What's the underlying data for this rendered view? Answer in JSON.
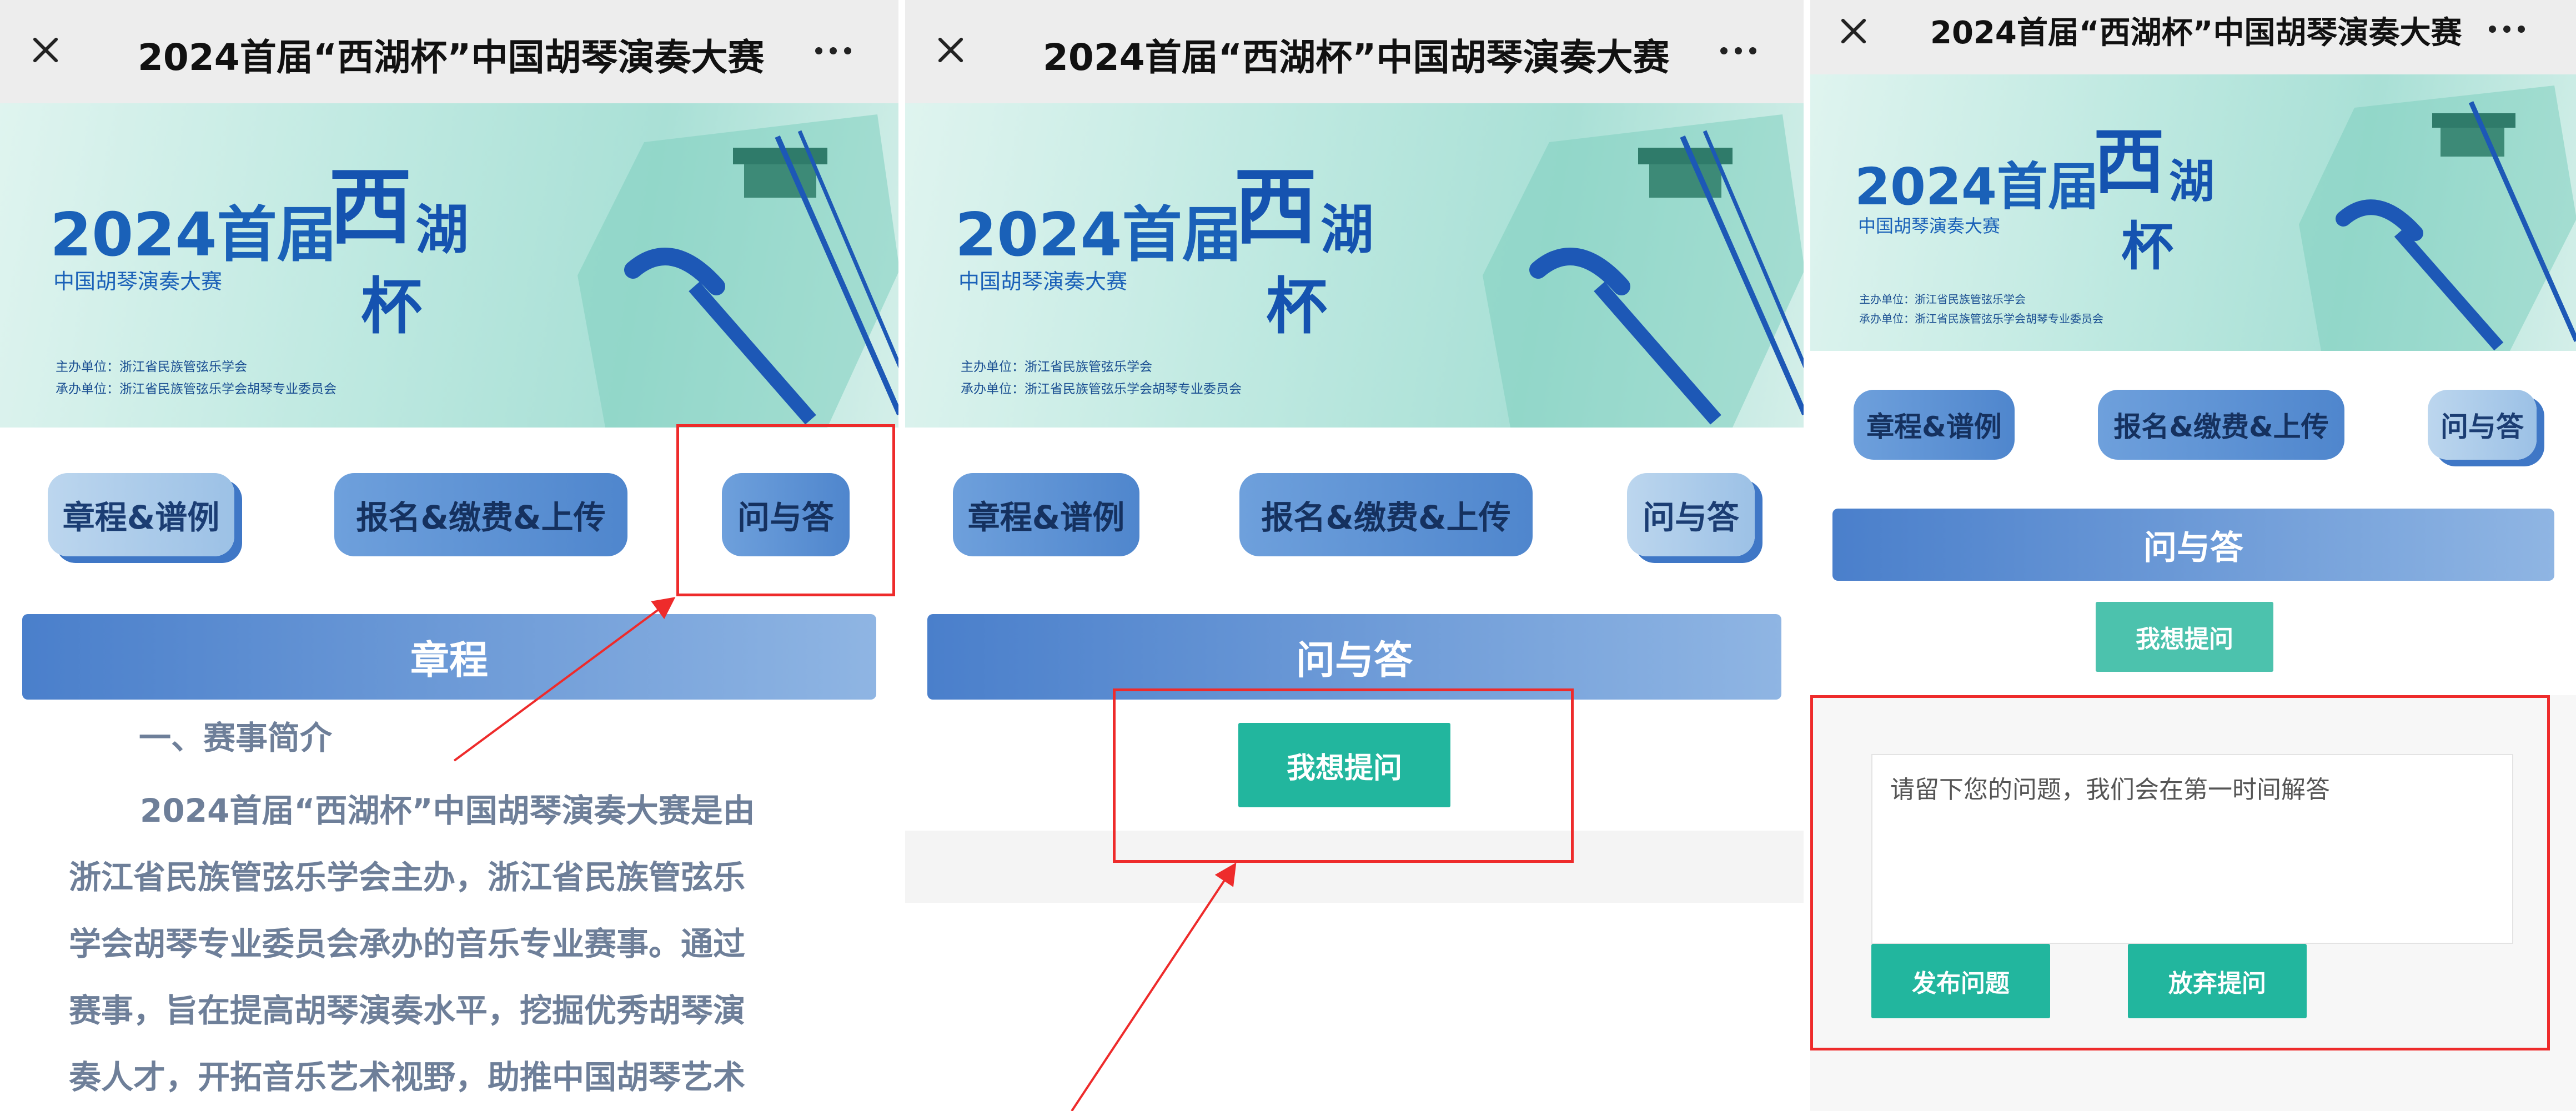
{
  "screens": [
    {
      "window": {
        "title": "2024首届“西湖杯”中国胡琴演奏大赛"
      },
      "banner": {
        "year": "2024首届",
        "sub": "中国胡琴演奏大赛",
        "cal1": "西",
        "cal2": "湖",
        "cal3": "杯",
        "org1": "主办单位：浙江省民族管弦乐学会",
        "org2": "承办单位：浙江省民族管弦乐学会胡琴专业委员会"
      },
      "tabs": [
        "章程&谱例",
        "报名&缴费&上传",
        "问与答"
      ],
      "section": "章程",
      "intro_heading": "一、赛事简介",
      "intro_lines": [
        "2024首届“西湖杯”中国胡琴演奏大赛是由",
        "浙江省民族管弦乐学会主办，浙江省民族管弦乐",
        "学会胡琴专业委员会承办的音乐专业赛事。通过",
        "赛事，旨在提高胡琴演奏水平，挖掘优秀胡琴演",
        "奏人才，开拓音乐艺术视野，助推中国胡琴艺术"
      ]
    },
    {
      "window": {
        "title": "2024首届“西湖杯”中国胡琴演奏大赛"
      },
      "banner": {
        "year": "2024首届",
        "sub": "中国胡琴演奏大赛",
        "cal1": "西",
        "cal2": "湖",
        "cal3": "杯",
        "org1": "主办单位：浙江省民族管弦乐学会",
        "org2": "承办单位：浙江省民族管弦乐学会胡琴专业委员会"
      },
      "tabs": [
        "章程&谱例",
        "报名&缴费&上传",
        "问与答"
      ],
      "section": "问与答",
      "ask_button": "我想提问"
    },
    {
      "window": {
        "title": "2024首届“西湖杯”中国胡琴演奏大赛"
      },
      "banner": {
        "year": "2024首届",
        "sub": "中国胡琴演奏大赛",
        "cal1": "西",
        "cal2": "湖",
        "cal3": "杯",
        "org1": "主办单位：浙江省民族管弦乐学会",
        "org2": "承办单位：浙江省民族管弦乐学会胡琴专业委员会"
      },
      "tabs": [
        "章程&谱例",
        "报名&缴费&上传",
        "问与答"
      ],
      "section": "问与答",
      "ask_button": "我想提问",
      "question_placeholder": "请留下您的问题，我们会在第一时间解答",
      "submit_button": "发布问题",
      "cancel_button": "放弃提问"
    }
  ],
  "colors": {
    "teal": "#22b69e",
    "annotation_red": "#ee2b2b",
    "section_blue": "#4a7fcb",
    "tab_light": "#bcd6ee",
    "tab_dark": "#4f86cd"
  },
  "icons": [
    "close-icon",
    "more-icon",
    "erhu-icon"
  ]
}
